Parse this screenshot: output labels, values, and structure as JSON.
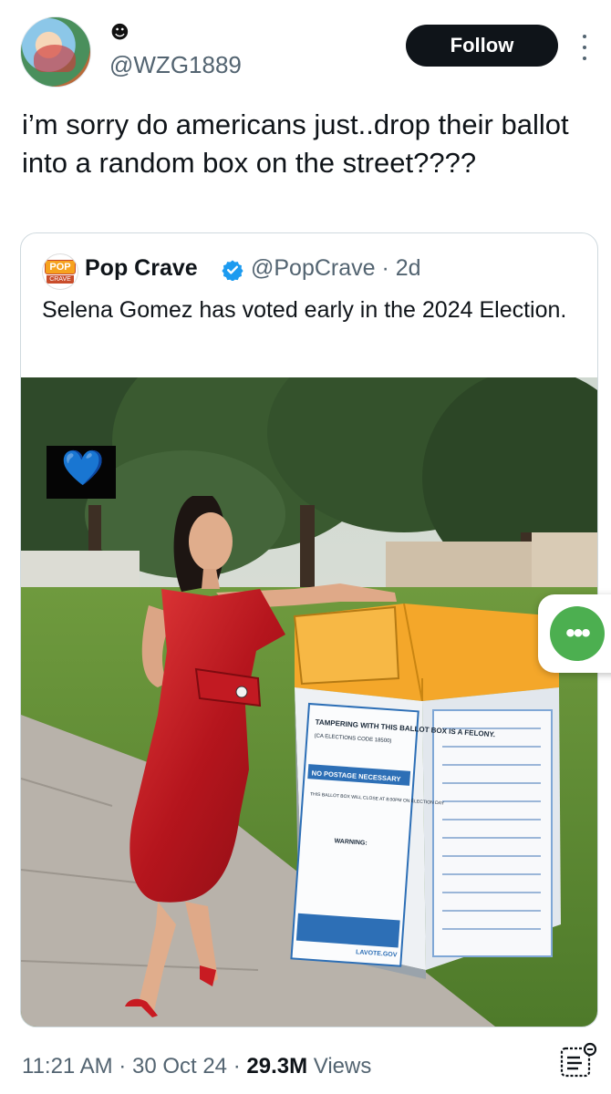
{
  "author": {
    "emoji": "☻",
    "handle": "@WZG1889"
  },
  "follow_label": "Follow",
  "tweet_text": "i’m sorry do americans just..drop their ballot into a random box on the street????",
  "quoted": {
    "name": "Pop Crave",
    "handle_time": "@PopCrave · 2d",
    "logo_top": "POP",
    "logo_bottom": "CRAVE",
    "text": "Selena Gomez has voted early in the 2024 Election.",
    "image": {
      "emoji": "💙",
      "box_sign_title": "TAMPERING WITH THIS BALLOT BOX IS A FELONY.",
      "box_sign_code": "(CA ELECTIONS CODE 18500)",
      "box_sign_banner": "NO POSTAGE NECESSARY",
      "box_sign_notice": "THIS BALLOT BOX WILL CLOSE AT 8:00PM ON ELECTION DAY",
      "box_sign_warning": "WARNING:",
      "box_sign_site": "LAVOTE.GOV"
    }
  },
  "footer": {
    "time": "11:21 AM",
    "date": "30 Oct 24",
    "views_count": "29.3M",
    "views_label": "Views"
  },
  "colors": {
    "follow_bg": "#0f1419",
    "verified": "#1d9bf0",
    "fab": "#4caf50",
    "muted_text": "#536471"
  }
}
